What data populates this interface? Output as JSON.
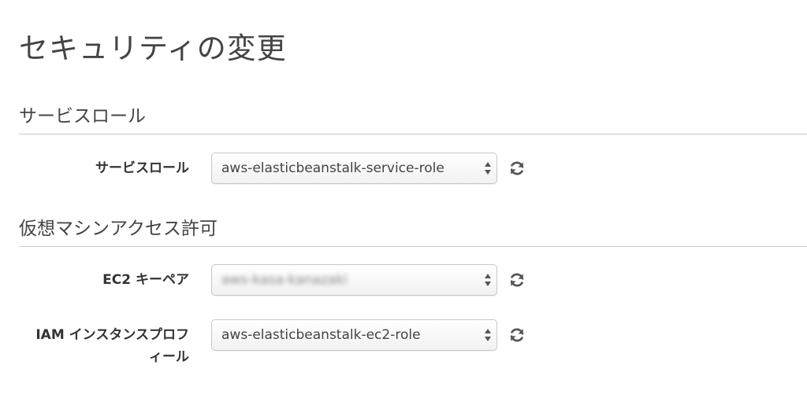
{
  "page": {
    "title": "セキュリティの変更"
  },
  "sections": {
    "service_role": {
      "title": "サービスロール",
      "field_label": "サービスロール",
      "selected_value": "aws-elasticbeanstalk-service-role"
    },
    "vm_access": {
      "title": "仮想マシンアクセス許可",
      "ec2_keypair": {
        "label": "EC2 キーペア",
        "selected_value": "aws-kasa-kanazaki"
      },
      "iam_profile": {
        "label_line1": "IAM インスタンスプロフ",
        "label_line2": "ィール",
        "selected_value": "aws-elasticbeanstalk-ec2-role"
      }
    }
  },
  "icons": {
    "refresh": "refresh-icon",
    "select_arrows": "select-arrows-icon"
  },
  "colors": {
    "text": "#333333",
    "heading": "#444444",
    "border": "#c8c8c8",
    "divider": "#cccccc",
    "icon": "#555555"
  }
}
